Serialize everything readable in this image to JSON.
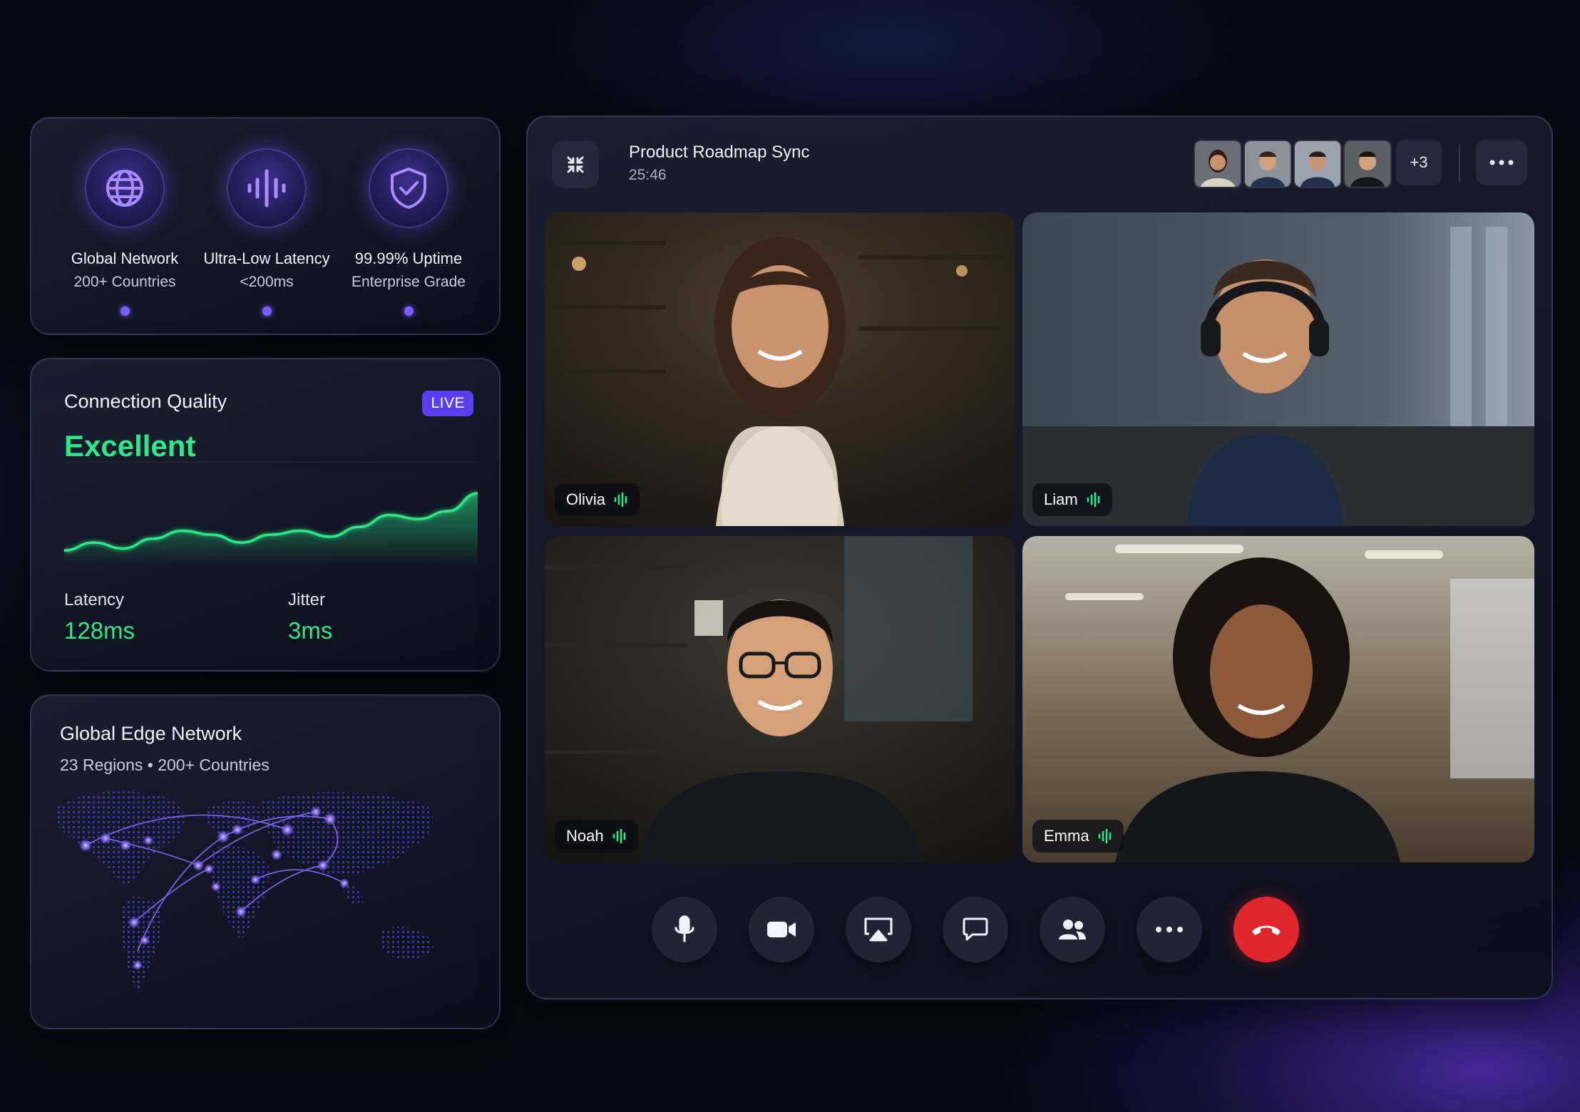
{
  "features": [
    {
      "icon": "globe-icon",
      "title": "Global Network",
      "subtitle": "200+ Countries"
    },
    {
      "icon": "audio-wave-icon",
      "title": "Ultra-Low Latency",
      "subtitle": "<200ms"
    },
    {
      "icon": "shield-check-icon",
      "title": "99.99% Uptime",
      "subtitle": "Enterprise Grade"
    }
  ],
  "connection": {
    "title": "Connection Quality",
    "badge": "LIVE",
    "status": "Excellent",
    "latency_label": "Latency",
    "latency_value": "128ms",
    "jitter_label": "Jitter",
    "jitter_value": "3ms",
    "accent": "#2bea86"
  },
  "chart_data": {
    "type": "area",
    "title": "",
    "xlabel": "",
    "ylabel": "",
    "values": [
      10,
      18,
      12,
      22,
      30,
      26,
      18,
      26,
      30,
      24,
      34,
      46,
      42,
      50,
      68
    ],
    "ylim": [
      0,
      100
    ],
    "grid": false,
    "color": "#2bea86"
  },
  "edge": {
    "title": "Global Edge Network",
    "subtitle": "23 Regions • 200+ Countries"
  },
  "call": {
    "title": "Product Roadmap Sync",
    "duration": "25:46",
    "extra_participants": "+3",
    "participants": [
      {
        "name": "Olivia"
      },
      {
        "name": "Liam"
      },
      {
        "name": "Noah"
      },
      {
        "name": "Emma"
      }
    ],
    "controls": [
      {
        "icon": "microphone-icon"
      },
      {
        "icon": "video-camera-icon"
      },
      {
        "icon": "screen-share-icon"
      },
      {
        "icon": "chat-icon"
      },
      {
        "icon": "participants-icon"
      },
      {
        "icon": "more-icon"
      },
      {
        "icon": "end-call-icon"
      }
    ]
  },
  "colors": {
    "accent_purple": "#7c5cff",
    "accent_green": "#2bea86",
    "danger": "#e0262e",
    "background": "#070a14"
  }
}
